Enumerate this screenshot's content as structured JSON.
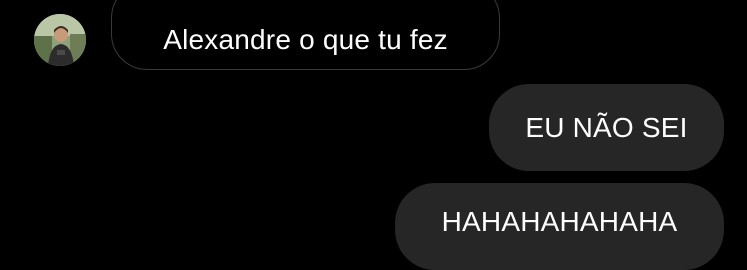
{
  "chat": {
    "contact": {
      "avatar_icon": "profile-photo-icon"
    },
    "messages": [
      {
        "direction": "received",
        "text": "Alexandre o que tu fez"
      },
      {
        "direction": "sent",
        "text": "EU NÃO SEI"
      },
      {
        "direction": "sent",
        "text": "HAHAHAHAHAHA"
      }
    ]
  },
  "colors": {
    "background": "#000000",
    "sent_bubble": "#262626",
    "received_border": "#3a3a3a",
    "text": "#ffffff"
  }
}
